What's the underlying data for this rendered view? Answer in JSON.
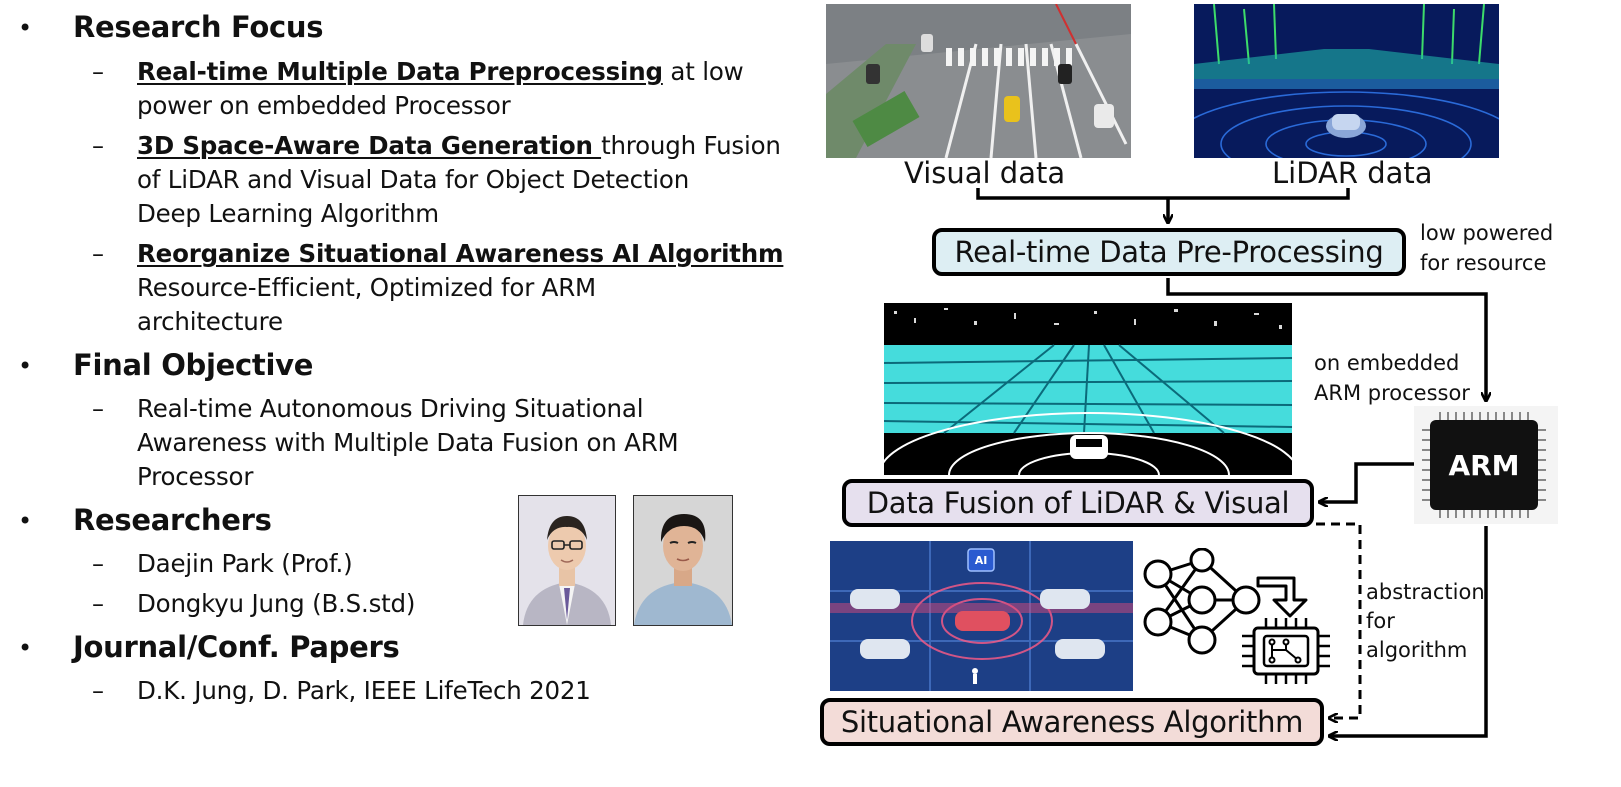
{
  "sections": {
    "research_focus": {
      "heading": "Research Focus",
      "items": [
        {
          "emph": "Real-time Multiple Data Preprocessing",
          "rest": " at low",
          "lines": [
            "power on embedded Processor"
          ]
        },
        {
          "emph": "3D Space-Aware Data Generation ",
          "rest": "through Fusion",
          "lines": [
            "of LiDAR and Visual Data for Object Detection",
            "Deep Learning Algorithm"
          ]
        },
        {
          "emph": "Reorganize Situational Awareness AI Algorithm",
          "rest": "",
          "lines": [
            "Resource-Efficient, Optimized for ARM",
            "architecture"
          ]
        }
      ]
    },
    "final_objective": {
      "heading": "Final Objective",
      "lines": [
        "Real-time Autonomous Driving Situational",
        "Awareness with Multiple Data Fusion on ARM",
        "Processor"
      ]
    },
    "researchers": {
      "heading": "Researchers",
      "items": [
        "Daejin Park (Prof.)",
        "Dongkyu Jung (B.S.std)"
      ]
    },
    "papers": {
      "heading": "Journal/Conf. Papers",
      "items": [
        "D.K. Jung, D. Park, IEEE  LifeTech 2021"
      ]
    },
    "bullet_glyph": "•",
    "dash_glyph": "–"
  },
  "diagram": {
    "visual_caption": "Visual data",
    "lidar_caption": "LiDAR data",
    "preprocess_box": "Real-time Data Pre-Processing",
    "preprocess_note": [
      "low powered",
      "for resource"
    ],
    "embedded_note": [
      "on embedded",
      "ARM processor"
    ],
    "arm_chip_label": "ARM",
    "fusion_box": "Data Fusion of LiDAR & Visual",
    "abstraction_note": [
      "abstraction",
      "for",
      "algorithm"
    ],
    "awareness_box": "Situational Awareness Algorithm",
    "ai_badge": "AI",
    "colors": {
      "preprocess_fill": "#ddeef3",
      "fusion_fill": "#e6e0ee",
      "awareness_fill": "#f3dcd8",
      "lidar_bg": "#0a1a5a",
      "fusion_cyan": "#3fe0e6",
      "scene_bg": "#1d3f86"
    }
  }
}
